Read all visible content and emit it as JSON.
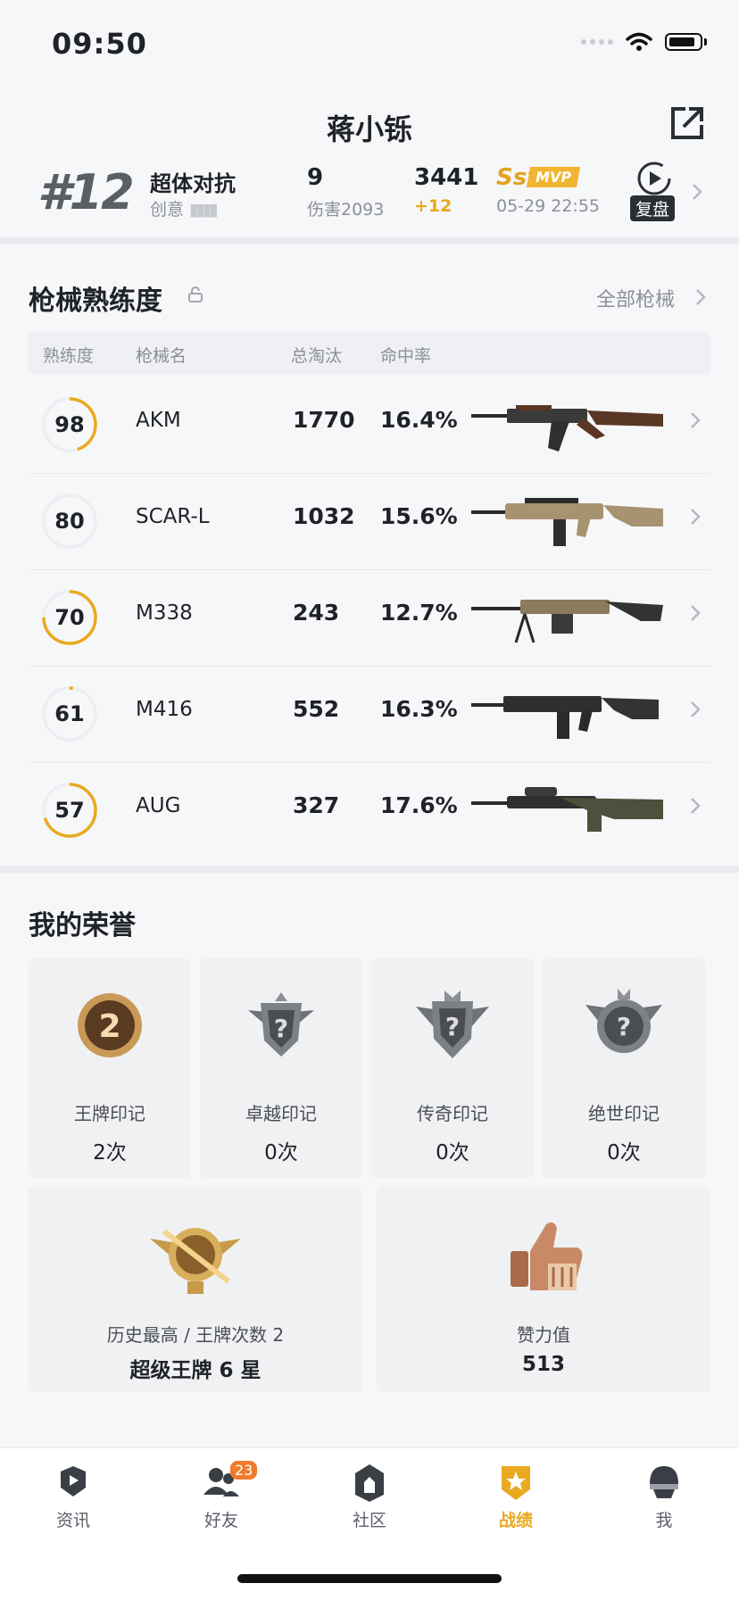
{
  "status_bar": {
    "time": "09:50"
  },
  "header": {
    "title": "蒋小铄"
  },
  "match": {
    "rank": "#12",
    "mode": "超体对抗",
    "creative": "创意",
    "kills": "9",
    "damage": "伤害2093",
    "score": "3441",
    "score_delta": "+12",
    "grade": "Ss⁺",
    "mvp": "MVP",
    "time": "05-29 22:55",
    "replay_label": "复盘"
  },
  "weapons": {
    "title": "枪械熟练度",
    "all_link": "全部枪械",
    "columns": [
      "熟练度",
      "枪械名",
      "总淘汰",
      "命中率"
    ],
    "rows": [
      {
        "level": "98",
        "progress": 0.45,
        "name": "AKM",
        "kills": "1770",
        "accuracy": "16.4%"
      },
      {
        "level": "80",
        "progress": 0.0,
        "name": "SCAR-L",
        "kills": "1032",
        "accuracy": "15.6%"
      },
      {
        "level": "70",
        "progress": 0.75,
        "name": "M338",
        "kills": "243",
        "accuracy": "12.7%"
      },
      {
        "level": "61",
        "progress": 0.02,
        "name": "M416",
        "kills": "552",
        "accuracy": "16.3%"
      },
      {
        "level": "57",
        "progress": 0.7,
        "name": "AUG",
        "kills": "327",
        "accuracy": "17.6%"
      }
    ]
  },
  "honors": {
    "title": "我的荣誉",
    "cards": [
      {
        "name": "王牌印记",
        "count": "2次",
        "icon": "ace-medal-icon"
      },
      {
        "name": "卓越印记",
        "count": "0次",
        "icon": "excellence-badge-icon"
      },
      {
        "name": "传奇印记",
        "count": "0次",
        "icon": "legend-badge-icon"
      },
      {
        "name": "绝世印记",
        "count": "0次",
        "icon": "peerless-badge-icon"
      }
    ],
    "best": {
      "name": "历史最高 / 王牌次数 2",
      "value": "超级王牌 6 星",
      "icon": "super-ace-emblem-icon"
    },
    "likes": {
      "name": "赞力值",
      "value": "513",
      "icon": "thumbs-up-icon"
    }
  },
  "tabs": [
    {
      "label": "资讯",
      "icon": "news-icon"
    },
    {
      "label": "好友",
      "icon": "friends-icon",
      "badge": "23"
    },
    {
      "label": "社区",
      "icon": "community-icon"
    },
    {
      "label": "战绩",
      "icon": "record-icon",
      "active": true
    },
    {
      "label": "我",
      "icon": "profile-icon"
    }
  ],
  "colors": {
    "accent": "#e9a920",
    "ring_track": "#eceef1",
    "badge": "#f07b2c"
  }
}
